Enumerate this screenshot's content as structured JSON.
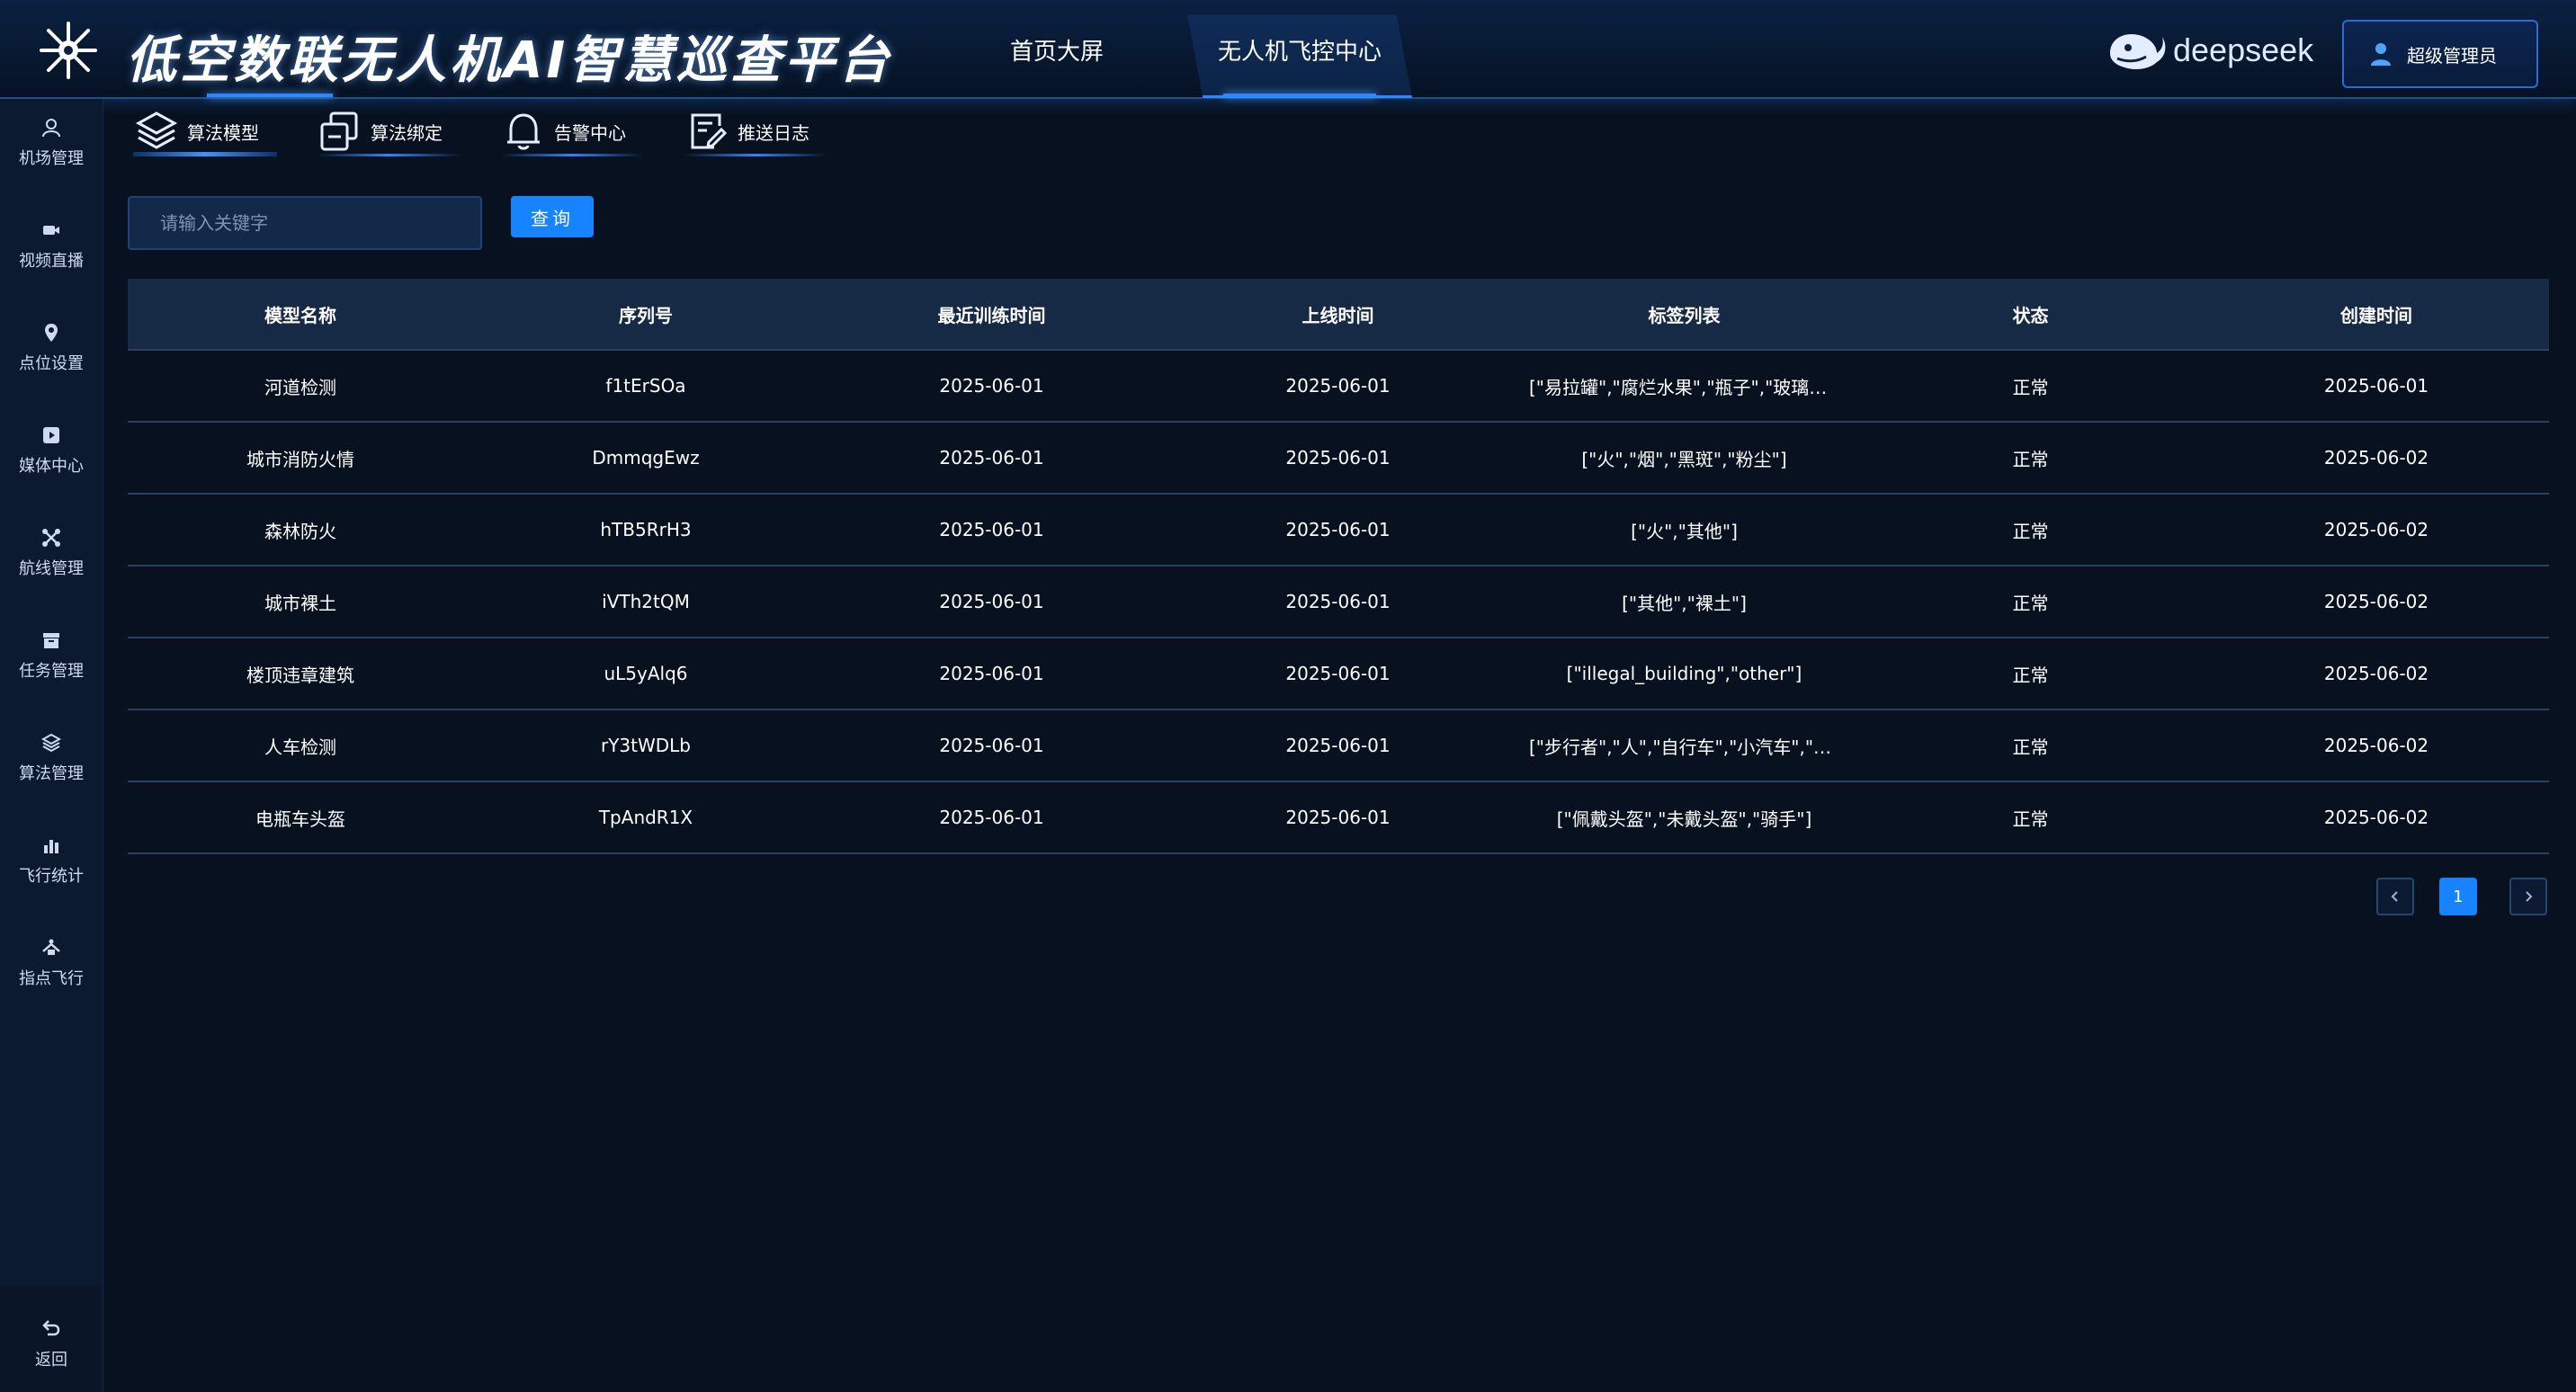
{
  "header": {
    "title": "低空数联无人机AI智慧巡查平台",
    "nav": [
      {
        "label": "首页大屏",
        "active": false
      },
      {
        "label": "无人机飞控中心",
        "active": true
      }
    ],
    "brand": {
      "text": "deepseek",
      "icon": "whale-logo-icon"
    },
    "user": {
      "name": "超级管理员",
      "icon": "user-icon"
    }
  },
  "sidebar": {
    "items": [
      {
        "label": "机场管理",
        "icon": "user-outline-icon"
      },
      {
        "label": "视频直播",
        "icon": "video-icon"
      },
      {
        "label": "点位设置",
        "icon": "location-pin-icon"
      },
      {
        "label": "媒体中心",
        "icon": "media-icon"
      },
      {
        "label": "航线管理",
        "icon": "route-icon"
      },
      {
        "label": "任务管理",
        "icon": "task-box-icon"
      },
      {
        "label": "算法管理",
        "icon": "layers-icon"
      },
      {
        "label": "飞行统计",
        "icon": "bar-chart-icon"
      },
      {
        "label": "指点飞行",
        "icon": "drone-point-icon"
      }
    ],
    "back": {
      "label": "返回",
      "icon": "return-arrow-icon"
    }
  },
  "subtabs": [
    {
      "label": "算法模型",
      "icon": "layers-icon",
      "active": true
    },
    {
      "label": "算法绑定",
      "icon": "copy-icon",
      "active": false
    },
    {
      "label": "告警中心",
      "icon": "bell-icon",
      "active": false
    },
    {
      "label": "推送日志",
      "icon": "edit-doc-icon",
      "active": false
    }
  ],
  "search": {
    "placeholder": "请输入关键字",
    "value": "",
    "button": "查询"
  },
  "table": {
    "columns": [
      "模型名称",
      "序列号",
      "最近训练时间",
      "上线时间",
      "标签列表",
      "状态",
      "创建时间"
    ],
    "rows": [
      [
        "河道检测",
        "f1tErSOa",
        "2025-06-01",
        "2025-06-01",
        "[\"易拉罐\",\"腐烂水果\",\"瓶子\",\"玻璃瓶…",
        "正常",
        "2025-06-01"
      ],
      [
        "城市消防火情",
        "DmmqgEwz",
        "2025-06-01",
        "2025-06-01",
        "[\"火\",\"烟\",\"黑斑\",\"粉尘\"]",
        "正常",
        "2025-06-02"
      ],
      [
        "森林防火",
        "hTB5RrH3",
        "2025-06-01",
        "2025-06-01",
        "[\"火\",\"其他\"]",
        "正常",
        "2025-06-02"
      ],
      [
        "城市裸土",
        "iVTh2tQM",
        "2025-06-01",
        "2025-06-01",
        "[\"其他\",\"裸土\"]",
        "正常",
        "2025-06-02"
      ],
      [
        "楼顶违章建筑",
        "uL5yAlq6",
        "2025-06-01",
        "2025-06-01",
        "[\"illegal_building\",\"other\"]",
        "正常",
        "2025-06-02"
      ],
      [
        "人车检测",
        "rY3tWDLb",
        "2025-06-01",
        "2025-06-01",
        "[\"步行者\",\"人\",\"自行车\",\"小汽车\",\"面…",
        "正常",
        "2025-06-02"
      ],
      [
        "电瓶车头盔",
        "TpAndR1X",
        "2025-06-01",
        "2025-06-01",
        "[\"佩戴头盔\",\"未戴头盔\",\"骑手\"]",
        "正常",
        "2025-06-02"
      ]
    ]
  },
  "pagination": {
    "current": "1",
    "prev_icon": "chevron-left-icon",
    "next_icon": "chevron-right-icon"
  },
  "colors": {
    "accent": "#1883ff",
    "bg": "#07111f",
    "header_bg": "#0a2144"
  }
}
